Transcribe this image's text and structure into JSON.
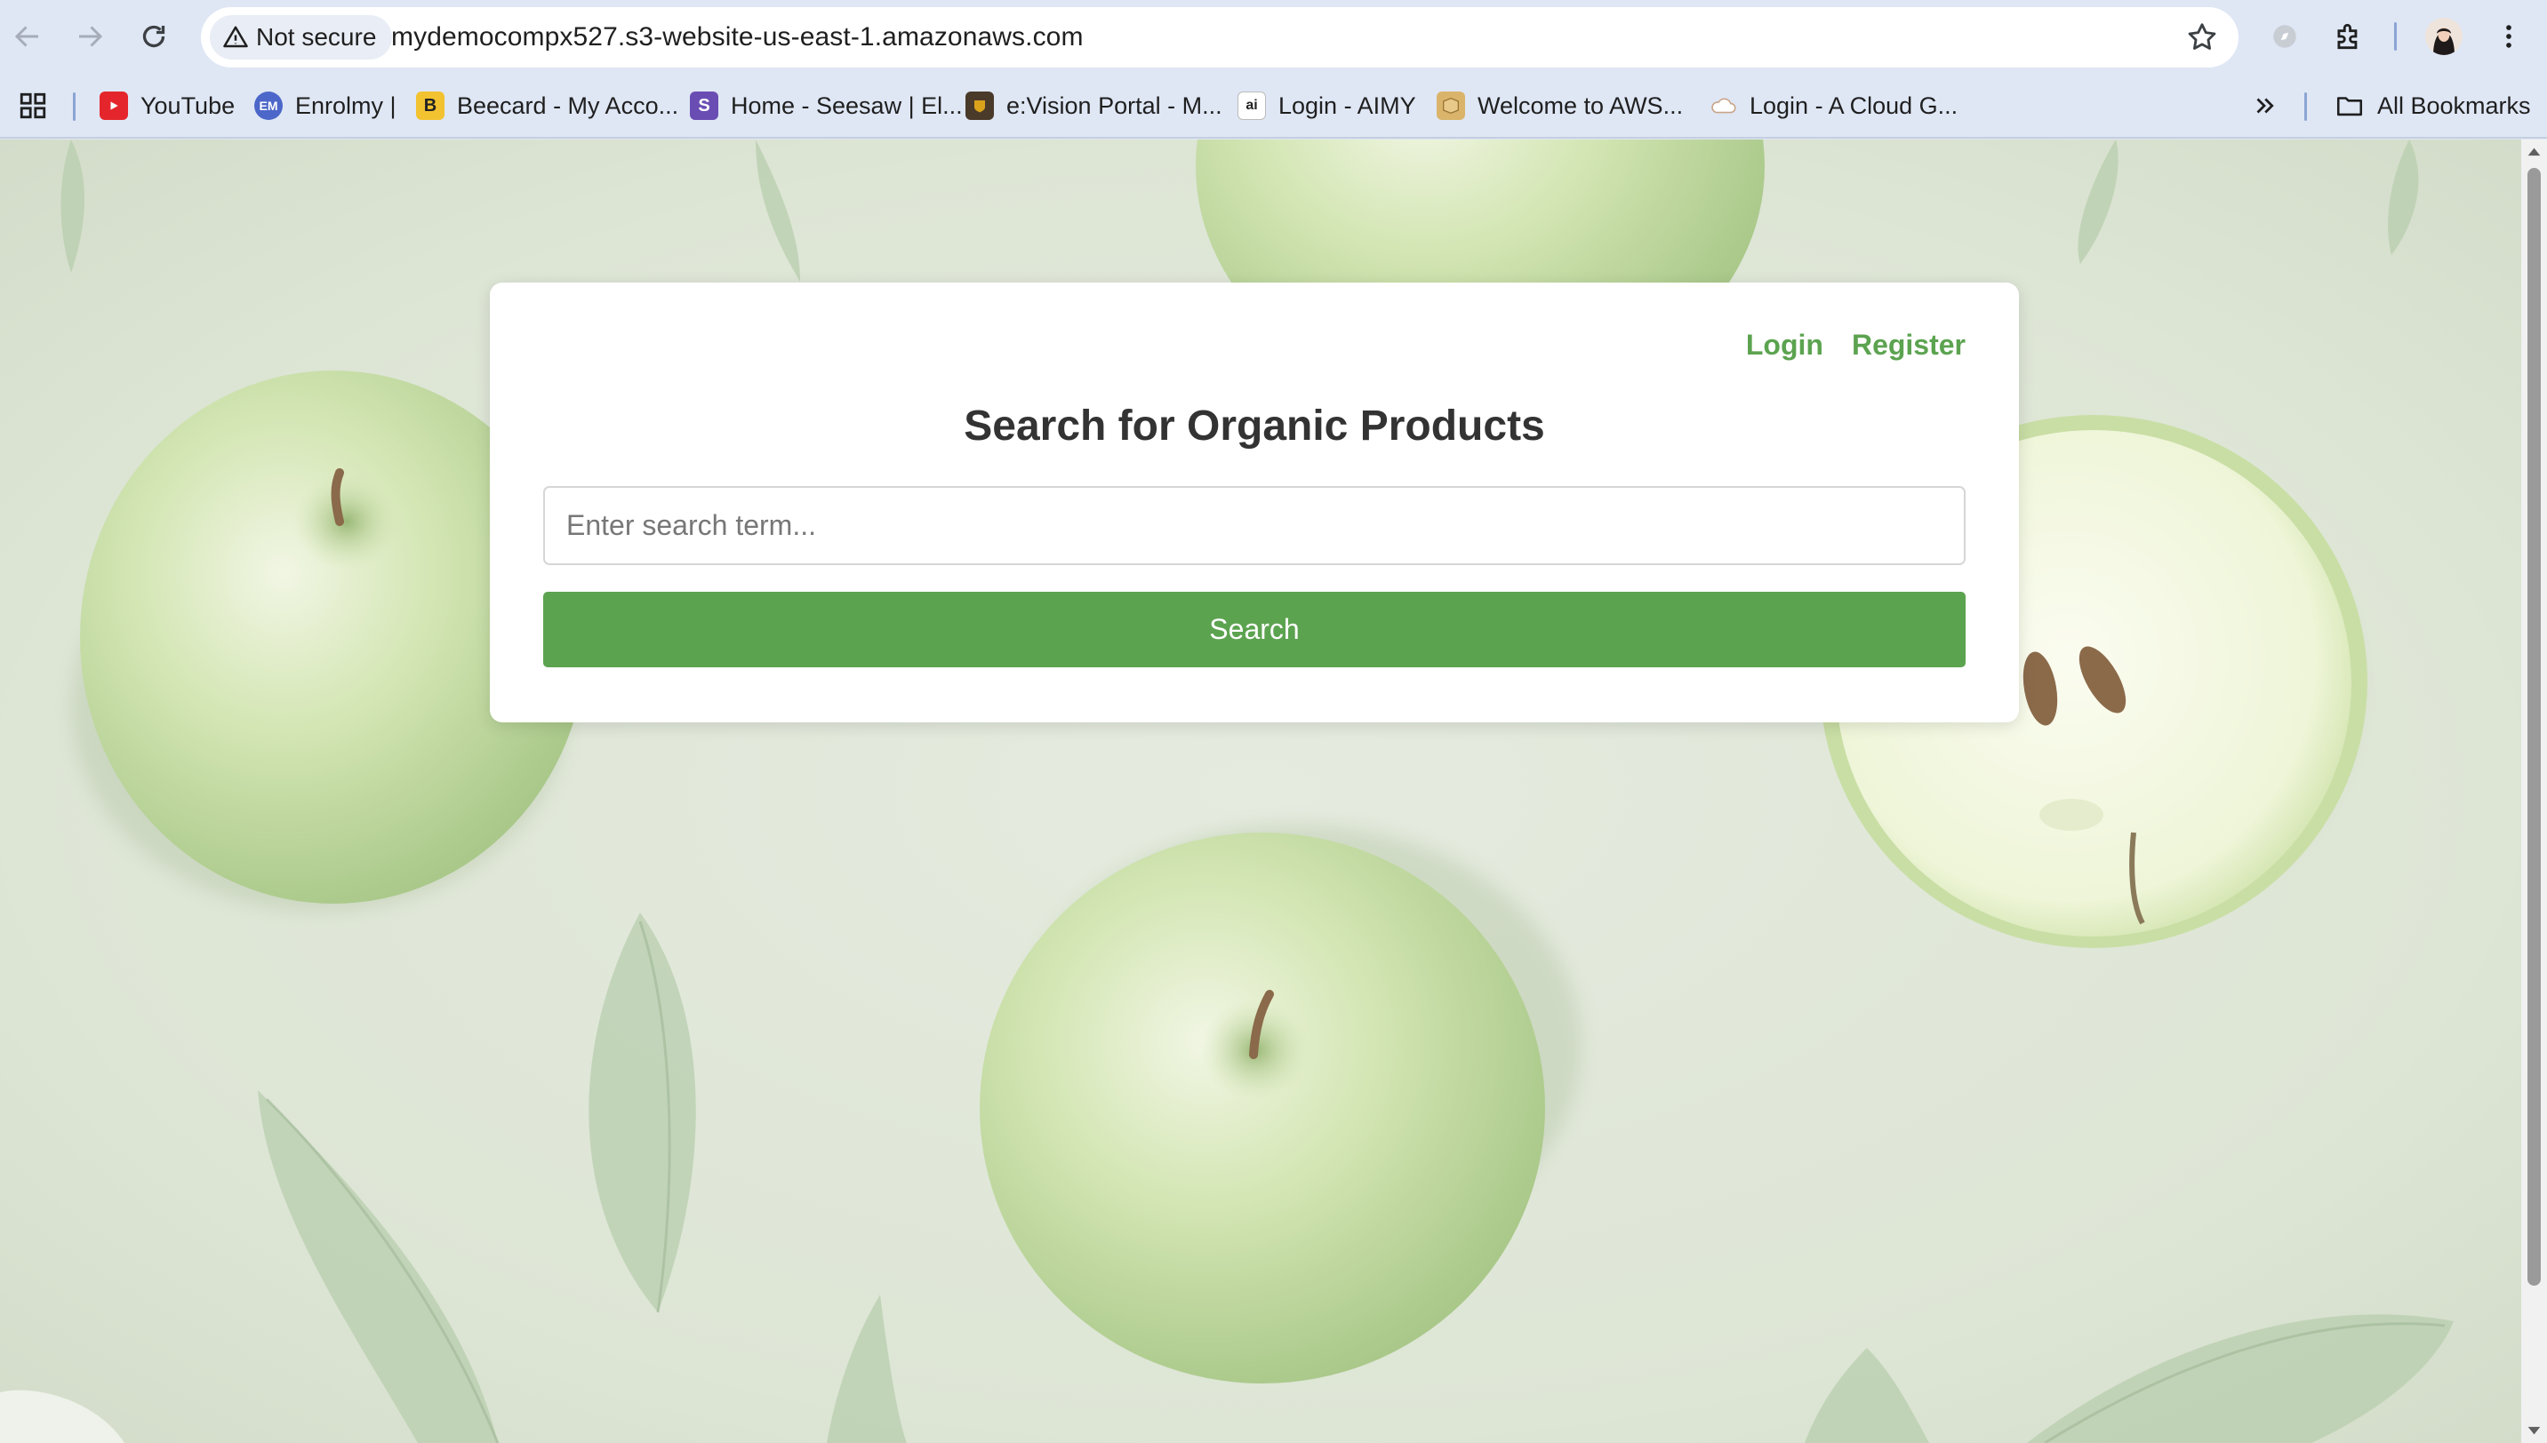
{
  "browser": {
    "security_chip": "Not secure",
    "url": "mydemocompx527.s3-website-us-east-1.amazonaws.com",
    "bookmarks": [
      {
        "label": "YouTube",
        "icon": "youtube-icon"
      },
      {
        "label": "Enrolmy |",
        "icon": "enrolmy-icon"
      },
      {
        "label": "Beecard - My Acco...",
        "icon": "beecard-icon"
      },
      {
        "label": "Home - Seesaw | El...",
        "icon": "seesaw-icon"
      },
      {
        "label": "e:Vision Portal - M...",
        "icon": "evision-icon"
      },
      {
        "label": "Login - AIMY",
        "icon": "aimy-icon"
      },
      {
        "label": "Welcome to AWS...",
        "icon": "aws-box-icon"
      },
      {
        "label": "Login - A Cloud G...",
        "icon": "cloud-icon"
      }
    ],
    "all_bookmarks_label": "All Bookmarks"
  },
  "page": {
    "login_label": "Login",
    "register_label": "Register",
    "title": "Search for Organic Products",
    "search_placeholder": "Enter search term...",
    "search_button_label": "Search"
  },
  "colors": {
    "accent_green": "#5ca350",
    "title_text": "#333333",
    "chrome_bg": "#dfe7f5"
  }
}
